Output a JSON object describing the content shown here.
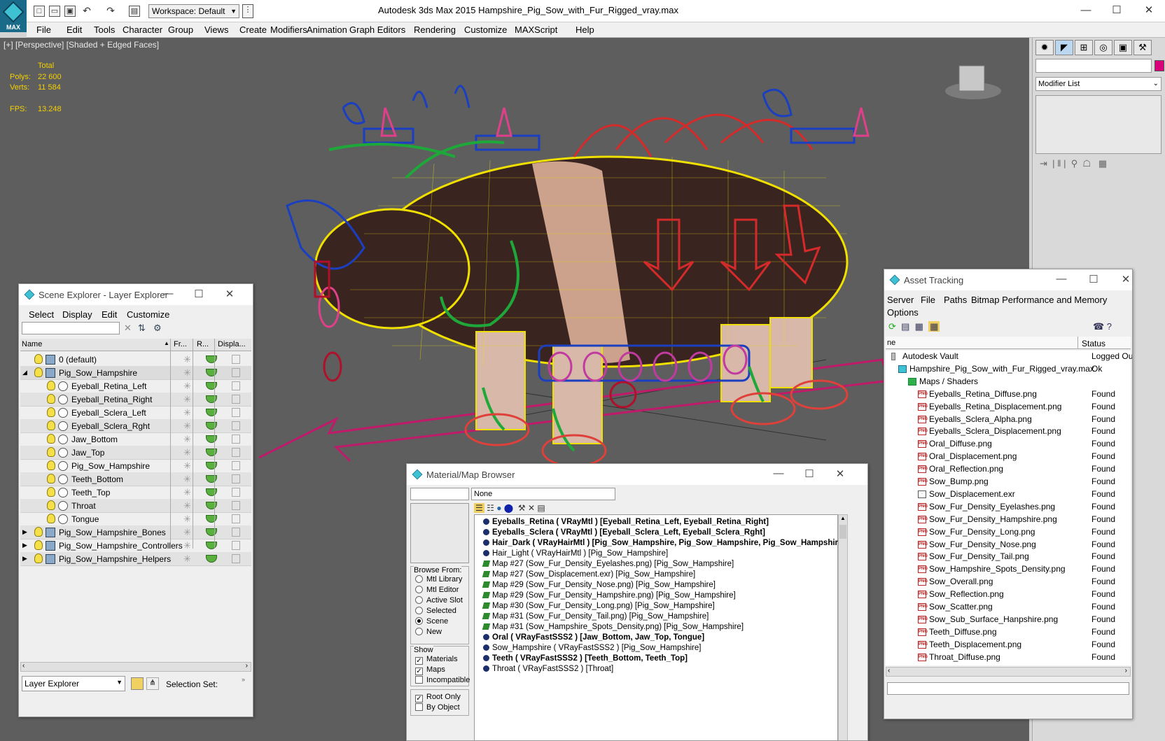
{
  "app": {
    "title": "Autodesk 3ds Max  2015      Hampshire_Pig_Sow_with_Fur_Rigged_vray.max",
    "logo_label": "MAX",
    "workspace": "Workspace: Default"
  },
  "menu": [
    "File",
    "Edit",
    "Tools",
    "Character",
    "Group",
    "Views",
    "Create",
    "Modifiers",
    "Animation",
    "Graph Editors",
    "Rendering",
    "Customize",
    "MAXScript",
    "Help"
  ],
  "viewport": {
    "label": "[+] [Perspective] [Shaded + Edged Faces]",
    "stats_header": "Total",
    "polys_label": "Polys:",
    "polys_value": "22 600",
    "verts_label": "Verts:",
    "verts_value": "11 584",
    "fps_label": "FPS:",
    "fps_value": "13.248"
  },
  "command_panel": {
    "modifier_list": "Modifier List",
    "accent_color": "#d8007a"
  },
  "scene_explorer": {
    "title": "Scene Explorer - Layer Explorer",
    "menu": [
      "Select",
      "Display",
      "Edit",
      "Customize"
    ],
    "columns": [
      "Name",
      "Fr...",
      "R...",
      "Displa..."
    ],
    "rows": [
      {
        "name": "0 (default)",
        "level": 0,
        "type": "layer"
      },
      {
        "name": "Pig_Sow_Hampshire",
        "level": 0,
        "type": "layer-active",
        "expanded": true
      },
      {
        "name": "Eyeball_Retina_Left",
        "level": 1,
        "type": "object"
      },
      {
        "name": "Eyeball_Retina_Right",
        "level": 1,
        "type": "object"
      },
      {
        "name": "Eyeball_Sclera_Left",
        "level": 1,
        "type": "object"
      },
      {
        "name": "Eyeball_Sclera_Rght",
        "level": 1,
        "type": "object"
      },
      {
        "name": "Jaw_Bottom",
        "level": 1,
        "type": "object"
      },
      {
        "name": "Jaw_Top",
        "level": 1,
        "type": "object"
      },
      {
        "name": "Pig_Sow_Hampshire",
        "level": 1,
        "type": "object"
      },
      {
        "name": "Teeth_Bottom",
        "level": 1,
        "type": "object"
      },
      {
        "name": "Teeth_Top",
        "level": 1,
        "type": "object"
      },
      {
        "name": "Throat",
        "level": 1,
        "type": "object"
      },
      {
        "name": "Tongue",
        "level": 1,
        "type": "object"
      },
      {
        "name": "Pig_Sow_Hampshire_Bones",
        "level": 0,
        "type": "layer",
        "collapsed": true
      },
      {
        "name": "Pig_Sow_Hampshire_Controllers",
        "level": 0,
        "type": "layer",
        "collapsed": true
      },
      {
        "name": "Pig_Sow_Hampshire_Helpers",
        "level": 0,
        "type": "layer",
        "collapsed": true
      }
    ],
    "explorer_select": "Layer Explorer",
    "selection_set_label": "Selection Set:"
  },
  "material_browser": {
    "title": "Material/Map Browser",
    "none_label": "None",
    "browse_from_label": "Browse From:",
    "browse_options": [
      "Mtl Library",
      "Mtl Editor",
      "Active Slot",
      "Selected",
      "Scene",
      "New"
    ],
    "browse_selected": "Scene",
    "show_label": "Show",
    "show_options": [
      {
        "label": "Materials",
        "checked": true
      },
      {
        "label": "Maps",
        "checked": true
      },
      {
        "label": "Incompatible",
        "checked": false
      }
    ],
    "root_options": [
      {
        "label": "Root Only",
        "checked": true
      },
      {
        "label": "By Object",
        "checked": false
      }
    ],
    "items": [
      {
        "text": "Eyeballs_Retina  ( VRayMtl ) [Eyeball_Retina_Left, Eyeball_Retina_Right]",
        "kind": "sphere",
        "bold": true
      },
      {
        "text": "Eyeballs_Sclera  ( VRayMtl ) [Eyeball_Sclera_Left, Eyeball_Sclera_Rght]",
        "kind": "sphere",
        "bold": true
      },
      {
        "text": "Hair_Dark  ( VRayHairMtl ) [Pig_Sow_Hampshire, Pig_Sow_Hampshire, Pig_Sow_Hampshire,",
        "kind": "sphere",
        "bold": true
      },
      {
        "text": "Hair_Light  ( VRayHairMtl )  [Pig_Sow_Hampshire]",
        "kind": "sphere",
        "bold": false
      },
      {
        "text": "Map #27 (Sow_Fur_Density_Eyelashes.png)  [Pig_Sow_Hampshire]",
        "kind": "map",
        "bold": false
      },
      {
        "text": "Map #27 (Sow_Displacement.exr)  [Pig_Sow_Hampshire]",
        "kind": "map",
        "bold": false
      },
      {
        "text": "Map #29 (Sow_Fur_Density_Nose.png)  [Pig_Sow_Hampshire]",
        "kind": "map",
        "bold": false
      },
      {
        "text": "Map #29 (Sow_Fur_Density_Hampshire.png)  [Pig_Sow_Hampshire]",
        "kind": "map",
        "bold": false
      },
      {
        "text": "Map #30 (Sow_Fur_Density_Long.png)  [Pig_Sow_Hampshire]",
        "kind": "map",
        "bold": false
      },
      {
        "text": "Map #31 (Sow_Fur_Density_Tail.png)  [Pig_Sow_Hampshire]",
        "kind": "map",
        "bold": false
      },
      {
        "text": "Map #31 (Sow_Hampshire_Spots_Density.png)  [Pig_Sow_Hampshire]",
        "kind": "map",
        "bold": false
      },
      {
        "text": "Oral  ( VRayFastSSS2 )  [Jaw_Bottom, Jaw_Top, Tongue]",
        "kind": "sphere",
        "bold": true
      },
      {
        "text": "Sow_Hampshire  ( VRayFastSSS2 )  [Pig_Sow_Hampshire]",
        "kind": "sphere",
        "bold": false
      },
      {
        "text": "Teeth  ( VRayFastSSS2 )  [Teeth_Bottom, Teeth_Top]",
        "kind": "sphere",
        "bold": true
      },
      {
        "text": "Throat  ( VRayFastSSS2 )  [Throat]",
        "kind": "sphere",
        "bold": false
      }
    ]
  },
  "asset_tracking": {
    "title": "Asset Tracking",
    "menu": [
      "Server",
      "File",
      "Paths",
      "Bitmap Performance and Memory"
    ],
    "menu2": "Options",
    "col_name": "ne",
    "col_status": "Status",
    "rows": [
      {
        "name": "Autodesk Vault",
        "status": "Logged Out",
        "level": 0,
        "type": "vault"
      },
      {
        "name": "Hampshire_Pig_Sow_with_Fur_Rigged_vray.max",
        "status": "Ok",
        "level": 1,
        "type": "max"
      },
      {
        "name": "Maps / Shaders",
        "status": "",
        "level": 2,
        "type": "folder"
      },
      {
        "name": "Eyeballs_Retina_Diffuse.png",
        "status": "Found",
        "level": 3,
        "type": "png"
      },
      {
        "name": "Eyeballs_Retina_Displacement.png",
        "status": "Found",
        "level": 3,
        "type": "png"
      },
      {
        "name": "Eyeballs_Sclera_Alpha.png",
        "status": "Found",
        "level": 3,
        "type": "png"
      },
      {
        "name": "Eyeballs_Sclera_Displacement.png",
        "status": "Found",
        "level": 3,
        "type": "png"
      },
      {
        "name": "Oral_Diffuse.png",
        "status": "Found",
        "level": 3,
        "type": "png"
      },
      {
        "name": "Oral_Displacement.png",
        "status": "Found",
        "level": 3,
        "type": "png"
      },
      {
        "name": "Oral_Reflection.png",
        "status": "Found",
        "level": 3,
        "type": "png"
      },
      {
        "name": "Sow_Bump.png",
        "status": "Found",
        "level": 3,
        "type": "png"
      },
      {
        "name": "Sow_Displacement.exr",
        "status": "Found",
        "level": 3,
        "type": "exr"
      },
      {
        "name": "Sow_Fur_Density_Eyelashes.png",
        "status": "Found",
        "level": 3,
        "type": "png"
      },
      {
        "name": "Sow_Fur_Density_Hampshire.png",
        "status": "Found",
        "level": 3,
        "type": "png"
      },
      {
        "name": "Sow_Fur_Density_Long.png",
        "status": "Found",
        "level": 3,
        "type": "png"
      },
      {
        "name": "Sow_Fur_Density_Nose.png",
        "status": "Found",
        "level": 3,
        "type": "png"
      },
      {
        "name": "Sow_Fur_Density_Tail.png",
        "status": "Found",
        "level": 3,
        "type": "png"
      },
      {
        "name": "Sow_Hampshire_Spots_Density.png",
        "status": "Found",
        "level": 3,
        "type": "png"
      },
      {
        "name": "Sow_Overall.png",
        "status": "Found",
        "level": 3,
        "type": "png"
      },
      {
        "name": "Sow_Reflection.png",
        "status": "Found",
        "level": 3,
        "type": "png"
      },
      {
        "name": "Sow_Scatter.png",
        "status": "Found",
        "level": 3,
        "type": "png"
      },
      {
        "name": "Sow_Sub_Surface_Hanpshire.png",
        "status": "Found",
        "level": 3,
        "type": "png"
      },
      {
        "name": "Teeth_Diffuse.png",
        "status": "Found",
        "level": 3,
        "type": "png"
      },
      {
        "name": "Teeth_Displacement.png",
        "status": "Found",
        "level": 3,
        "type": "png"
      },
      {
        "name": "Throat_Diffuse.png",
        "status": "Found",
        "level": 3,
        "type": "png"
      }
    ]
  }
}
